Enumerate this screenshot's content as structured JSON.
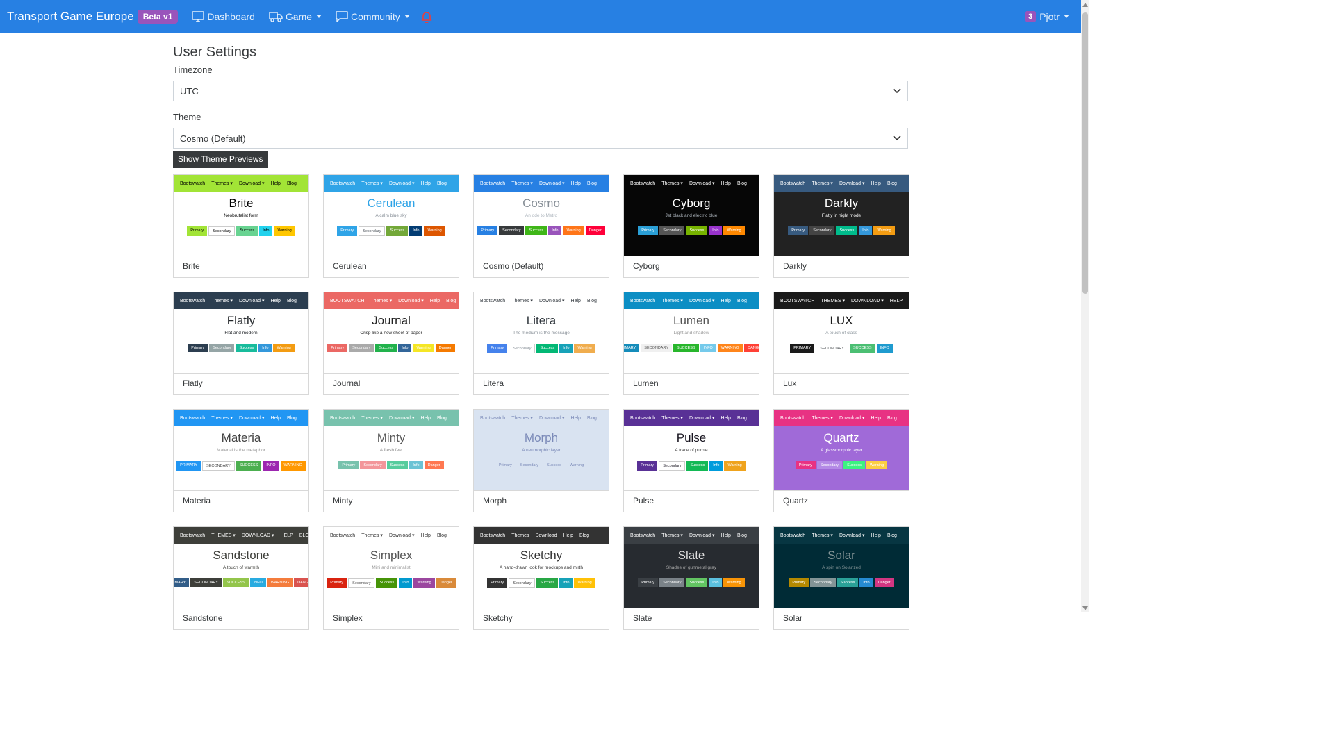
{
  "navbar": {
    "brand": "Transport Game Europe",
    "badge": "Beta v1",
    "items": [
      {
        "label": "Dashboard",
        "icon": "monitor-icon"
      },
      {
        "label": "Game",
        "icon": "truck-icon"
      },
      {
        "label": "Community",
        "icon": "chat-icon"
      }
    ],
    "user": {
      "count": "3",
      "name": "Pjotr"
    }
  },
  "settings": {
    "title": "User Settings",
    "timezone_label": "Timezone",
    "timezone_value": "UTC",
    "theme_label": "Theme",
    "theme_value": "Cosmo (Default)",
    "preview_button": "Show Theme Previews"
  },
  "themes": [
    {
      "name": "Brite",
      "title": "Brite",
      "subtitle": "Neobrutalist form",
      "nav": [
        "Bootswatch",
        "Themes ▾",
        "Download ▾",
        "Help",
        "Blog"
      ],
      "buttons": [
        "Primary",
        "Secondary",
        "Success",
        "Info",
        "Warning"
      ],
      "navbg": "#a2e436",
      "navfg": "#000000",
      "bodybg": "#ffffff",
      "titlecolor": "#000000",
      "subcolor": "#000000",
      "btncolors": [
        "#a2e436",
        "#ffffff",
        "#68d391",
        "#22d2ed",
        "#ffc700"
      ],
      "btnfg": [
        "#000000",
        "#000000",
        "#000000",
        "#000000",
        "#000000"
      ]
    },
    {
      "name": "Cerulean",
      "title": "Cerulean",
      "subtitle": "A calm blue sky",
      "nav": [
        "Bootswatch",
        "Themes ▾",
        "Download ▾",
        "Help",
        "Blog"
      ],
      "buttons": [
        "Primary",
        "Secondary",
        "Success",
        "Info",
        "Warning"
      ],
      "navbg": "#2fa4e7",
      "navfg": "#ffffff",
      "bodybg": "#ffffff",
      "titlecolor": "#2fa4e7",
      "subcolor": "#868e96",
      "btncolors": [
        "#2fa4e7",
        "#ffffff",
        "#73a839",
        "#033c73",
        "#dd5600"
      ],
      "btnfg": [
        "#ffffff",
        "#495057",
        "#ffffff",
        "#ffffff",
        "#ffffff"
      ]
    },
    {
      "name": "Cosmo (Default)",
      "title": "Cosmo",
      "subtitle": "An ode to Metro",
      "nav": [
        "Bootswatch",
        "Themes ▾",
        "Download ▾",
        "Help",
        "Blog"
      ],
      "buttons": [
        "Primary",
        "Secondary",
        "Success",
        "Info",
        "Warning",
        "Danger"
      ],
      "navbg": "#2780e3",
      "navfg": "#ffffff",
      "bodybg": "#ffffff",
      "titlecolor": "#868e96",
      "subcolor": "#adb5bd",
      "btncolors": [
        "#2780e3",
        "#373a3c",
        "#3fb618",
        "#9954bb",
        "#ff7518",
        "#ff0039"
      ],
      "btnfg": [
        "#ffffff",
        "#ffffff",
        "#ffffff",
        "#ffffff",
        "#ffffff",
        "#ffffff"
      ]
    },
    {
      "name": "Cyborg",
      "title": "Cyborg",
      "subtitle": "Jet black and electric blue",
      "nav": [
        "Bootswatch",
        "Themes ▾",
        "Download ▾",
        "Help",
        "Blog"
      ],
      "buttons": [
        "Primary",
        "Secondary",
        "Success",
        "Info",
        "Warning"
      ],
      "navbg": "#060606",
      "navfg": "#ffffff",
      "bodybg": "#060606",
      "titlecolor": "#ffffff",
      "subcolor": "#adb5bd",
      "btncolors": [
        "#2a9fd6",
        "#555555",
        "#77b300",
        "#9933cc",
        "#ff8800"
      ],
      "btnfg": [
        "#ffffff",
        "#ffffff",
        "#ffffff",
        "#ffffff",
        "#ffffff"
      ]
    },
    {
      "name": "Darkly",
      "title": "Darkly",
      "subtitle": "Flatly in night mode",
      "nav": [
        "Bootswatch",
        "Themes ▾",
        "Download ▾",
        "Help",
        "Blog"
      ],
      "buttons": [
        "Primary",
        "Secondary",
        "Success",
        "Info",
        "Warning"
      ],
      "navbg": "#375a7f",
      "navfg": "#ffffff",
      "bodybg": "#222222",
      "titlecolor": "#ffffff",
      "subcolor": "#ffffff",
      "btncolors": [
        "#375a7f",
        "#444444",
        "#00bc8c",
        "#3498db",
        "#f39c12"
      ],
      "btnfg": [
        "#ffffff",
        "#ffffff",
        "#ffffff",
        "#ffffff",
        "#ffffff"
      ]
    },
    {
      "name": "Flatly",
      "title": "Flatly",
      "subtitle": "Flat and modern",
      "nav": [
        "Bootswatch",
        "Themes ▾",
        "Download ▾",
        "Help",
        "Blog"
      ],
      "buttons": [
        "Primary",
        "Secondary",
        "Success",
        "Info",
        "Warning"
      ],
      "navbg": "#2c3e50",
      "navfg": "#ffffff",
      "bodybg": "#ffffff",
      "titlecolor": "#212529",
      "subcolor": "#212529",
      "btncolors": [
        "#2c3e50",
        "#95a5a6",
        "#18bc9c",
        "#3498db",
        "#f39c12"
      ],
      "btnfg": [
        "#ffffff",
        "#ffffff",
        "#ffffff",
        "#ffffff",
        "#ffffff"
      ]
    },
    {
      "name": "Journal",
      "title": "Journal",
      "subtitle": "Crisp like a new sheet of paper",
      "nav": [
        "BOOTSWATCH",
        "Themes ▾",
        "Download ▾",
        "Help",
        "Blog"
      ],
      "buttons": [
        "Primary",
        "Secondary",
        "Success",
        "Info",
        "Warning",
        "Danger"
      ],
      "navbg": "#eb6864",
      "navfg": "#ffffff",
      "bodybg": "#ffffff",
      "titlecolor": "#222222",
      "subcolor": "#222222",
      "btncolors": [
        "#eb6864",
        "#aaaaaa",
        "#22b24c",
        "#336699",
        "#f5e625",
        "#f57a00"
      ],
      "btnfg": [
        "#ffffff",
        "#ffffff",
        "#ffffff",
        "#ffffff",
        "#ffffff",
        "#ffffff"
      ]
    },
    {
      "name": "Litera",
      "title": "Litera",
      "subtitle": "The medium is the message",
      "nav": [
        "Bootswatch",
        "Themes ▾",
        "Download ▾",
        "Help",
        "Blog"
      ],
      "buttons": [
        "Primary",
        "Secondary",
        "Success",
        "Info",
        "Warning"
      ],
      "navbg": "#ffffff",
      "navfg": "#343a40",
      "bodybg": "#ffffff",
      "titlecolor": "#343a40",
      "subcolor": "#868e96",
      "btncolors": [
        "#4582ec",
        "#ffffff",
        "#02b875",
        "#17a2b8",
        "#f0ad4e"
      ],
      "btnfg": [
        "#ffffff",
        "#868e96",
        "#ffffff",
        "#ffffff",
        "#ffffff"
      ]
    },
    {
      "name": "Lumen",
      "title": "Lumen",
      "subtitle": "Light and shadow",
      "nav": [
        "Bootswatch",
        "Themes ▾",
        "Download ▾",
        "Help",
        "Blog"
      ],
      "buttons": [
        "PRIMARY",
        "SECONDARY",
        "SUCCESS",
        "INFO",
        "WARNING",
        "DANGER"
      ],
      "navbg": "#0c8ec4",
      "navfg": "#ffffff",
      "bodybg": "#ffffff",
      "titlecolor": "#555555",
      "subcolor": "#999999",
      "btncolors": [
        "#158cba",
        "#f0f0f0",
        "#28b62c",
        "#75caeb",
        "#ff851b",
        "#ff4136"
      ],
      "btnfg": [
        "#ffffff",
        "#555555",
        "#ffffff",
        "#ffffff",
        "#ffffff",
        "#ffffff"
      ]
    },
    {
      "name": "Lux",
      "title": "LUX",
      "subtitle": "A touch of class",
      "nav": [
        "BOOTSWATCH",
        "THEMES ▾",
        "DOWNLOAD ▾",
        "HELP"
      ],
      "buttons": [
        "PRIMARY",
        "SECONDARY",
        "SUCCESS",
        "INFO"
      ],
      "navbg": "#1a1a1a",
      "navfg": "#ffffff",
      "bodybg": "#ffffff",
      "titlecolor": "#1a1a1a",
      "subcolor": "#919aa1",
      "btncolors": [
        "#1a1a1a",
        "#ffffff",
        "#4bbf73",
        "#1f9bcf"
      ],
      "btnfg": [
        "#ffffff",
        "#55595c",
        "#ffffff",
        "#ffffff"
      ]
    },
    {
      "name": "Materia",
      "title": "Materia",
      "subtitle": "Material is the metaphor",
      "nav": [
        "Bootswatch",
        "Themes ▾",
        "Download ▾",
        "Help",
        "Blog"
      ],
      "buttons": [
        "PRIMARY",
        "SECONDARY",
        "SUCCESS",
        "INFO",
        "WARNING"
      ],
      "navbg": "#2196f3",
      "navfg": "#ffffff",
      "bodybg": "#ffffff",
      "titlecolor": "#444444",
      "subcolor": "#999999",
      "btncolors": [
        "#2196f3",
        "#ffffff",
        "#4caf50",
        "#9c27b0",
        "#ff9800"
      ],
      "btnfg": [
        "#ffffff",
        "#444444",
        "#ffffff",
        "#ffffff",
        "#ffffff"
      ]
    },
    {
      "name": "Minty",
      "title": "Minty",
      "subtitle": "A fresh feel",
      "nav": [
        "Bootswatch",
        "Themes ▾",
        "Download ▾",
        "Help",
        "Blog"
      ],
      "buttons": [
        "Primary",
        "Secondary",
        "Success",
        "Info",
        "Danger"
      ],
      "navbg": "#78c2ad",
      "navfg": "#ffffff",
      "bodybg": "#ffffff",
      "titlecolor": "#5a5a5a",
      "subcolor": "#888888",
      "btncolors": [
        "#78c2ad",
        "#f3969a",
        "#56cc9d",
        "#6cc3d5",
        "#ff7851"
      ],
      "btnfg": [
        "#ffffff",
        "#ffffff",
        "#ffffff",
        "#ffffff",
        "#ffffff"
      ]
    },
    {
      "name": "Morph",
      "title": "Morph",
      "subtitle": "A neumorphic layer",
      "nav": [
        "Bootswatch",
        "Themes ▾",
        "Download ▾",
        "Help",
        "Blog"
      ],
      "buttons": [
        "Primary",
        "Secondary",
        "Success",
        "Warning"
      ],
      "navbg": "#d9e3f1",
      "navfg": "#7b8ab8",
      "bodybg": "#d9e3f1",
      "titlecolor": "#7b8ab8",
      "subcolor": "#7b8ab8",
      "btncolors": [
        "#d9e3f1",
        "#d9e3f1",
        "#d9e3f1",
        "#d9e3f1"
      ],
      "btnfg": [
        "#7b8ab8",
        "#7b8ab8",
        "#7b8ab8",
        "#7b8ab8"
      ]
    },
    {
      "name": "Pulse",
      "title": "Pulse",
      "subtitle": "A trace of purple",
      "nav": [
        "Bootswatch",
        "Themes ▾",
        "Download ▾",
        "Help",
        "Blog"
      ],
      "buttons": [
        "Primary",
        "Secondary",
        "Success",
        "Info",
        "Warning"
      ],
      "navbg": "#593196",
      "navfg": "#ffffff",
      "bodybg": "#ffffff",
      "titlecolor": "#17141f",
      "subcolor": "#444444",
      "btncolors": [
        "#593196",
        "#ffffff",
        "#13b955",
        "#009cdc",
        "#efa31d"
      ],
      "btnfg": [
        "#ffffff",
        "#17141f",
        "#ffffff",
        "#ffffff",
        "#ffffff"
      ]
    },
    {
      "name": "Quartz",
      "title": "Quartz",
      "subtitle": "A glassmorphic layer",
      "nav": [
        "Bootswatch",
        "Themes ▾",
        "Download ▾",
        "Help",
        "Blog"
      ],
      "buttons": [
        "Primary",
        "Secondary",
        "Success",
        "Warning"
      ],
      "navbg": "#e83283",
      "navfg": "#ffffff",
      "bodybg": "#a06ad8",
      "titlecolor": "#ffffff",
      "subcolor": "#ffffff",
      "btncolors": [
        "#e83283",
        "#b48ae6",
        "#3cf281",
        "#fcce42"
      ],
      "btnfg": [
        "#ffffff",
        "#ffffff",
        "#ffffff",
        "#ffffff"
      ]
    },
    {
      "name": "Sandstone",
      "title": "Sandstone",
      "subtitle": "A touch of warmth",
      "nav": [
        "Bootswatch",
        "THEMES ▾",
        "DOWNLOAD ▾",
        "HELP",
        "BLOG"
      ],
      "buttons": [
        "PRIMARY",
        "SECONDARY",
        "SUCCESS",
        "INFO",
        "WARNING",
        "DANGER"
      ],
      "navbg": "#3e3f3a",
      "navfg": "#ffffff",
      "bodybg": "#ffffff",
      "titlecolor": "#3e3f3a",
      "subcolor": "#3e3f3a",
      "btncolors": [
        "#325d88",
        "#3e3f3a",
        "#93c54b",
        "#29abe0",
        "#f47c3c",
        "#d9534f"
      ],
      "btnfg": [
        "#ffffff",
        "#ffffff",
        "#ffffff",
        "#ffffff",
        "#ffffff",
        "#ffffff"
      ]
    },
    {
      "name": "Simplex",
      "title": "Simplex",
      "subtitle": "Mini and minimalist",
      "nav": [
        "Bootswatch",
        "Themes ▾",
        "Download ▾",
        "Help",
        "Blog"
      ],
      "buttons": [
        "Primary",
        "Secondary",
        "Success",
        "Info",
        "Warning",
        "Danger"
      ],
      "navbg": "#ffffff",
      "navfg": "#333333",
      "bodybg": "#ffffff",
      "titlecolor": "#555555",
      "subcolor": "#999999",
      "btncolors": [
        "#d9230f",
        "#ffffff",
        "#469408",
        "#029acf",
        "#9b479f",
        "#d98a3a"
      ],
      "btnfg": [
        "#ffffff",
        "#555555",
        "#ffffff",
        "#ffffff",
        "#ffffff",
        "#ffffff"
      ]
    },
    {
      "name": "Sketchy",
      "title": "Sketchy",
      "subtitle": "A hand-drawn look for mockups and mirth",
      "nav": [
        "Bootswatch",
        "Themes",
        "Download",
        "Help",
        "Blog"
      ],
      "buttons": [
        "Primary",
        "Secondary",
        "Success",
        "Info",
        "Warning"
      ],
      "navbg": "#333333",
      "navfg": "#ffffff",
      "bodybg": "#ffffff",
      "titlecolor": "#333333",
      "subcolor": "#333333",
      "btncolors": [
        "#333333",
        "#ffffff",
        "#28a745",
        "#17a2b8",
        "#ffc107"
      ],
      "btnfg": [
        "#ffffff",
        "#333333",
        "#ffffff",
        "#ffffff",
        "#ffffff"
      ]
    },
    {
      "name": "Slate",
      "title": "Slate",
      "subtitle": "Shades of gunmetal gray",
      "nav": [
        "Bootswatch",
        "Themes ▾",
        "Download ▾",
        "Help",
        "Blog"
      ],
      "buttons": [
        "Primary",
        "Secondary",
        "Success",
        "Info",
        "Warning"
      ],
      "navbg": "#3a3f44",
      "navfg": "#ffffff",
      "bodybg": "#272b30",
      "titlecolor": "#dddddd",
      "subcolor": "#aaaaaa",
      "btncolors": [
        "#3a3f44",
        "#7a8288",
        "#62c462",
        "#5bc0de",
        "#f89406"
      ],
      "btnfg": [
        "#ffffff",
        "#ffffff",
        "#ffffff",
        "#ffffff",
        "#ffffff"
      ]
    },
    {
      "name": "Solar",
      "title": "Solar",
      "subtitle": "A spin on Solarized",
      "nav": [
        "Bootswatch",
        "Themes ▾",
        "Download ▾",
        "Help",
        "Blog"
      ],
      "buttons": [
        "Primary",
        "Secondary",
        "Success",
        "Info",
        "Danger"
      ],
      "navbg": "#073642",
      "navfg": "#ffffff",
      "bodybg": "#002b36",
      "titlecolor": "#839496",
      "subcolor": "#839496",
      "btncolors": [
        "#b58900",
        "#839496",
        "#2aa198",
        "#268bd2",
        "#d33682"
      ],
      "btnfg": [
        "#ffffff",
        "#ffffff",
        "#ffffff",
        "#ffffff",
        "#ffffff"
      ]
    }
  ]
}
